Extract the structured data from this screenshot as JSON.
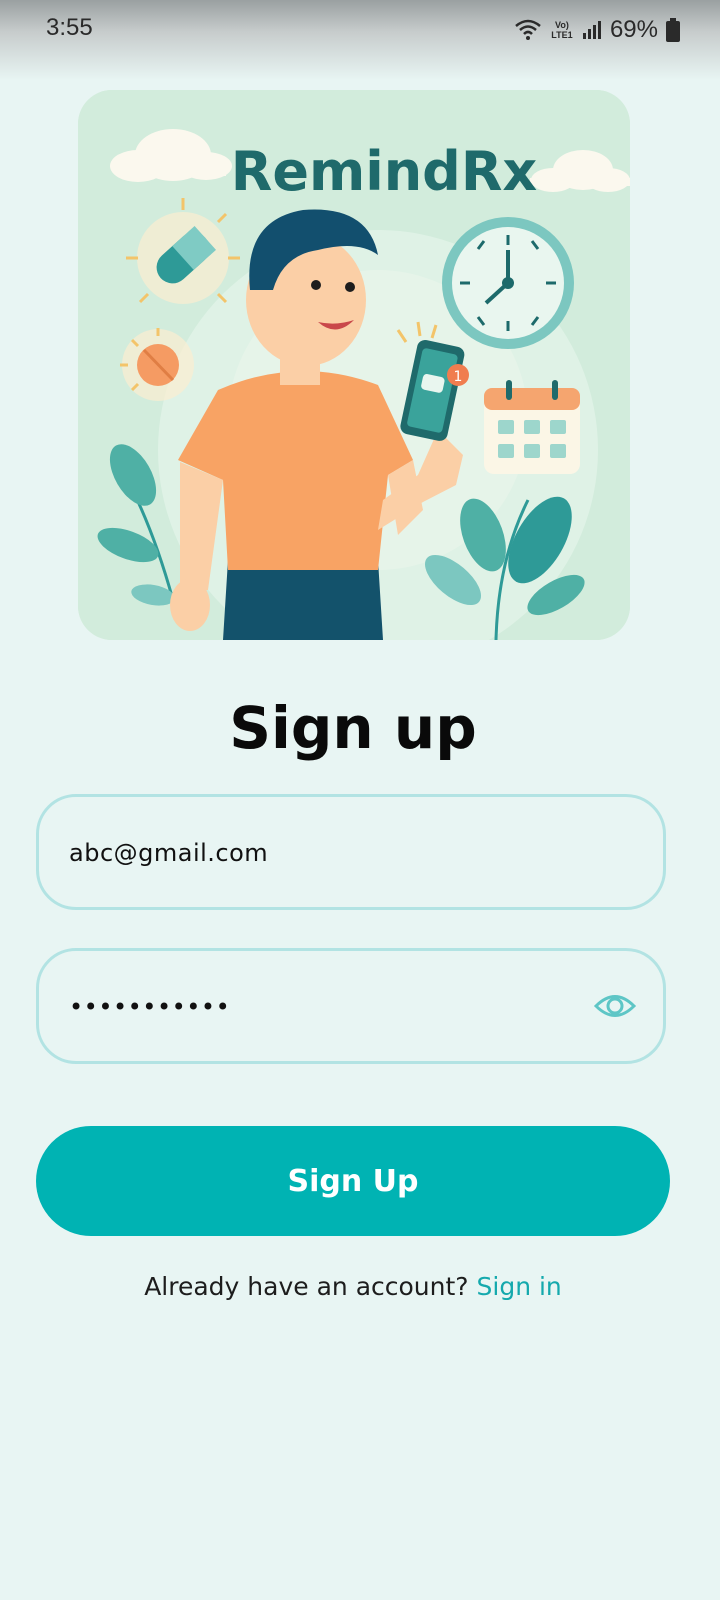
{
  "status_bar": {
    "time": "3:55",
    "network_label": "Vo) LTE1",
    "battery": "69%"
  },
  "hero": {
    "brand": "RemindRx",
    "notification_count": "1"
  },
  "form": {
    "title": "Sign up",
    "email_value": "abc@gmail.com",
    "password_value": "•••••••••••",
    "submit_label": "Sign Up"
  },
  "footer": {
    "prompt": "Already have an account?",
    "signin_label": "Sign in"
  },
  "icons": {
    "wifi": "wifi-icon",
    "signal": "signal-icon",
    "battery": "battery-icon",
    "eye": "eye-icon"
  },
  "colors": {
    "primary": "#00b3b3",
    "accent_link": "#14a9ad",
    "brand": "#1f6a6b",
    "background": "#e8f5f3"
  }
}
